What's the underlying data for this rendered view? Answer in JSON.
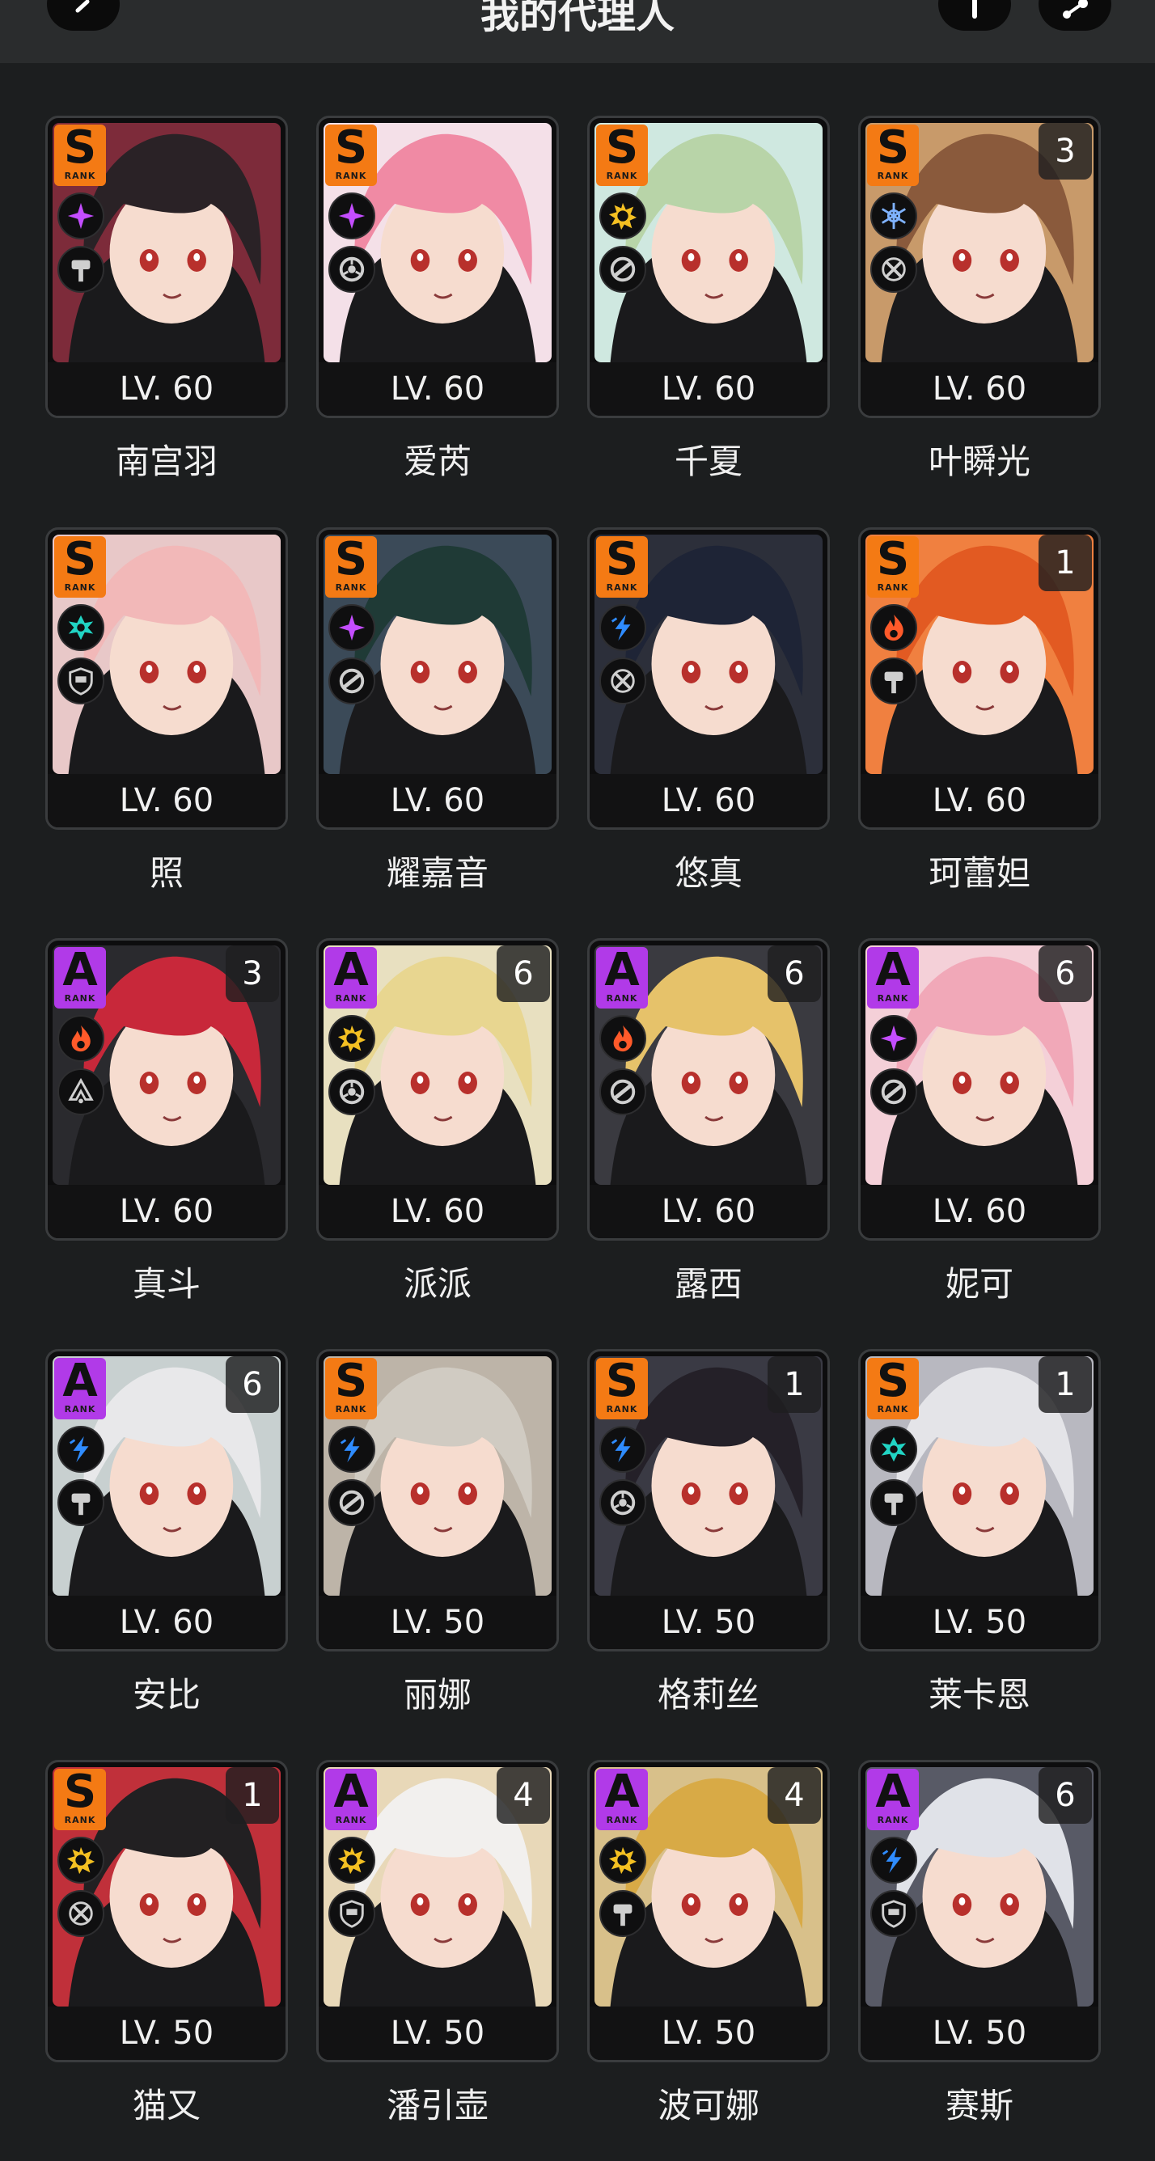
{
  "header": {
    "title": "我的代理人"
  },
  "colors": {
    "rank_s": "#f47a14",
    "rank_a": "#b13ae8",
    "attr_ether": "#c44dff",
    "attr_physical": "#f4c022",
    "attr_ice": "#7fb2ff",
    "attr_frost": "#7fb2ff",
    "attr_fire": "#ff5a2a",
    "attr_electric": "#2f8cff",
    "attr_wind": "#21d4c4"
  },
  "agents": [
    {
      "name": "南宫羽",
      "level": "LV. 60",
      "rank": "S",
      "rank_word": "RANK",
      "mindscape": "",
      "attribute": "ether",
      "specialty": "stun"
    },
    {
      "name": "爱芮",
      "level": "LV. 60",
      "rank": "S",
      "rank_word": "RANK",
      "mindscape": "",
      "attribute": "ether",
      "specialty": "anomaly"
    },
    {
      "name": "千夏",
      "level": "LV. 60",
      "rank": "S",
      "rank_word": "RANK",
      "mindscape": "",
      "attribute": "physical",
      "specialty": "support"
    },
    {
      "name": "叶瞬光",
      "level": "LV. 60",
      "rank": "S",
      "rank_word": "RANK",
      "mindscape": "3",
      "attribute": "frost",
      "specialty": "attack"
    },
    {
      "name": "照",
      "level": "LV. 60",
      "rank": "S",
      "rank_word": "RANK",
      "mindscape": "",
      "attribute": "wind",
      "specialty": "defense"
    },
    {
      "name": "耀嘉音",
      "level": "LV. 60",
      "rank": "S",
      "rank_word": "RANK",
      "mindscape": "",
      "attribute": "ether",
      "specialty": "support"
    },
    {
      "name": "悠真",
      "level": "LV. 60",
      "rank": "S",
      "rank_word": "RANK",
      "mindscape": "",
      "attribute": "electric",
      "specialty": "attack"
    },
    {
      "name": "珂蕾妲",
      "level": "LV. 60",
      "rank": "S",
      "rank_word": "RANK",
      "mindscape": "1",
      "attribute": "fire",
      "specialty": "stun"
    },
    {
      "name": "真斗",
      "level": "LV. 60",
      "rank": "A",
      "rank_word": "RANK",
      "mindscape": "3",
      "attribute": "fire",
      "specialty": "rupture"
    },
    {
      "name": "派派",
      "level": "LV. 60",
      "rank": "A",
      "rank_word": "RANK",
      "mindscape": "6",
      "attribute": "physical",
      "specialty": "anomaly"
    },
    {
      "name": "露西",
      "level": "LV. 60",
      "rank": "A",
      "rank_word": "RANK",
      "mindscape": "6",
      "attribute": "fire",
      "specialty": "support"
    },
    {
      "name": "妮可",
      "level": "LV. 60",
      "rank": "A",
      "rank_word": "RANK",
      "mindscape": "6",
      "attribute": "ether",
      "specialty": "support"
    },
    {
      "name": "安比",
      "level": "LV. 60",
      "rank": "A",
      "rank_word": "RANK",
      "mindscape": "6",
      "attribute": "electric",
      "specialty": "stun"
    },
    {
      "name": "丽娜",
      "level": "LV. 50",
      "rank": "S",
      "rank_word": "RANK",
      "mindscape": "",
      "attribute": "electric",
      "specialty": "support"
    },
    {
      "name": "格莉丝",
      "level": "LV. 50",
      "rank": "S",
      "rank_word": "RANK",
      "mindscape": "1",
      "attribute": "electric",
      "specialty": "anomaly"
    },
    {
      "name": "莱卡恩",
      "level": "LV. 50",
      "rank": "S",
      "rank_word": "RANK",
      "mindscape": "1",
      "attribute": "wind",
      "specialty": "stun"
    },
    {
      "name": "猫又",
      "level": "LV. 50",
      "rank": "S",
      "rank_word": "RANK",
      "mindscape": "1",
      "attribute": "physical",
      "specialty": "attack"
    },
    {
      "name": "潘引壶",
      "level": "LV. 50",
      "rank": "A",
      "rank_word": "RANK",
      "mindscape": "4",
      "attribute": "physical",
      "specialty": "defense"
    },
    {
      "name": "波可娜",
      "level": "LV. 50",
      "rank": "A",
      "rank_word": "RANK",
      "mindscape": "4",
      "attribute": "physical",
      "specialty": "stun"
    },
    {
      "name": "赛斯",
      "level": "LV. 50",
      "rank": "A",
      "rank_word": "RANK",
      "mindscape": "6",
      "attribute": "electric",
      "specialty": "defense"
    }
  ]
}
